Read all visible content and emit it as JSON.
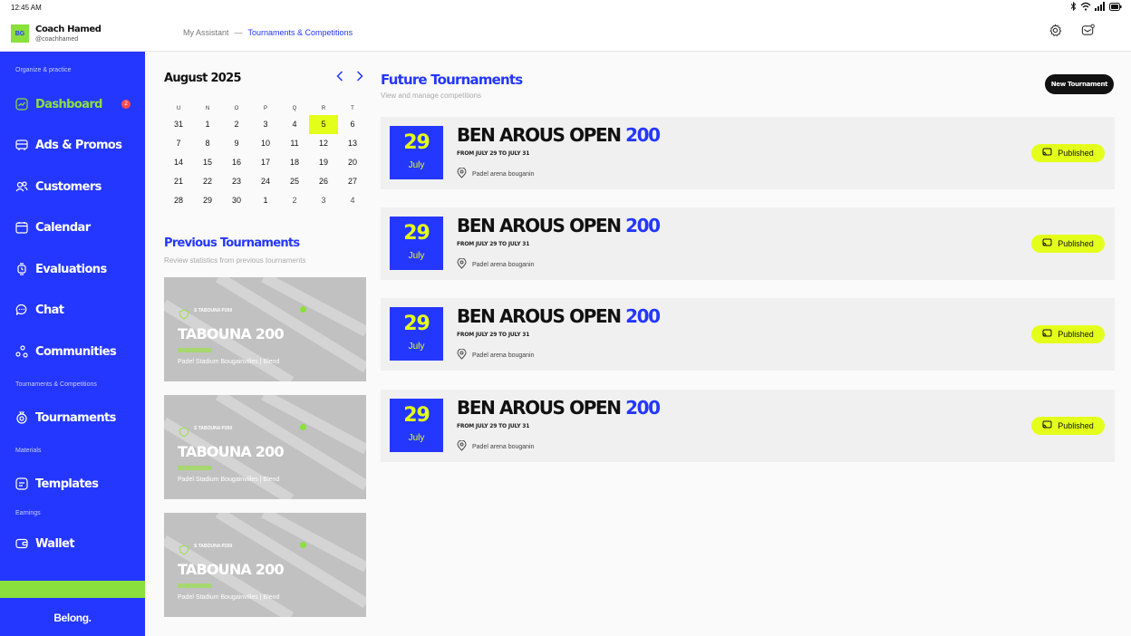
{
  "status_bar": {
    "time": "12:45 AM"
  },
  "user": {
    "initials": "BG",
    "name": "Coach Hamed",
    "handle": "@coachhamed"
  },
  "sidebar": {
    "sections": {
      "organize": "Organize & practice",
      "tournaments": "Tournaments & Competitions",
      "materials": "Materials",
      "earnings": "Earnings"
    },
    "items": [
      {
        "label": "Dashboard",
        "icon": "chart-line-icon",
        "active": true,
        "badge": "2"
      },
      {
        "label": "Ads & Promos",
        "icon": "megaphone-icon"
      },
      {
        "label": "Customers",
        "icon": "users-icon"
      },
      {
        "label": "Calendar",
        "icon": "calendar-icon"
      },
      {
        "label": "Evaluations",
        "icon": "watch-icon"
      },
      {
        "label": "Chat",
        "icon": "chat-icon"
      },
      {
        "label": "Communities",
        "icon": "communities-icon"
      },
      {
        "label": "Tournaments",
        "icon": "trophy-icon"
      },
      {
        "label": "Templates",
        "icon": "template-icon"
      },
      {
        "label": "Wallet",
        "icon": "wallet-icon"
      }
    ],
    "logo": "Belong.",
    "colors": {
      "primary": "#2437ff",
      "accent_green": "#8ae03c",
      "accent_yellow": "#e4ff1a"
    }
  },
  "breadcrumb": {
    "parent": "My Assistant",
    "separator": "—",
    "current": "Tournaments & Competitions"
  },
  "calendar": {
    "title": "August 2025",
    "weekdays": [
      "U",
      "N",
      "O",
      "P",
      "Q",
      "R",
      "T"
    ],
    "weeks": [
      [
        "31",
        "1",
        "2",
        "3",
        "4",
        "5",
        "6"
      ],
      [
        "7",
        "8",
        "9",
        "10",
        "11",
        "12",
        "13"
      ],
      [
        "14",
        "15",
        "16",
        "17",
        "18",
        "19",
        "20"
      ],
      [
        "21",
        "22",
        "23",
        "24",
        "25",
        "26",
        "27"
      ],
      [
        "28",
        "29",
        "30",
        "1",
        "2",
        "3",
        "4"
      ]
    ],
    "selected": "5"
  },
  "previous": {
    "title": "Previous Tournaments",
    "subtitle": "Review statistics from previous tournaments",
    "cards": [
      {
        "small_title": "S TABOUNA P200",
        "title": "TABOUNA 200",
        "location": "Padel Stadium Bougainvilles  | Blend"
      },
      {
        "small_title": "S TABOUNA P200",
        "title": "TABOUNA 200",
        "location": "Padel Stadium Bougainvilles  | Blend"
      },
      {
        "small_title": "S TABOUNA P200",
        "title": "TABOUNA 200",
        "location": "Padel Stadium Bougainvilles  | Blend"
      }
    ]
  },
  "future": {
    "title": "Future Tournaments",
    "subtitle": "View and manage  competitions",
    "new_button": "New Tournament",
    "cards": [
      {
        "day": "29",
        "month": "July",
        "name": "BEN AROUS OPEN ",
        "level": "200",
        "range": "FROM JULY 29 TO JULY 31",
        "location": "Padel arena bouganin",
        "status": "Published"
      },
      {
        "day": "29",
        "month": "July",
        "name": "BEN AROUS OPEN ",
        "level": "200",
        "range": "FROM JULY 29 TO JULY 31",
        "location": "Padel arena bouganin",
        "status": "Published"
      },
      {
        "day": "29",
        "month": "July",
        "name": "BEN AROUS OPEN ",
        "level": "200",
        "range": "FROM JULY 29 TO JULY 31",
        "location": "Padel arena bouganin",
        "status": "Published"
      },
      {
        "day": "29",
        "month": "July",
        "name": "BEN AROUS OPEN ",
        "level": "200",
        "range": "FROM JULY 29 TO JULY 31",
        "location": "Padel arena bouganin",
        "status": "Published"
      }
    ]
  }
}
